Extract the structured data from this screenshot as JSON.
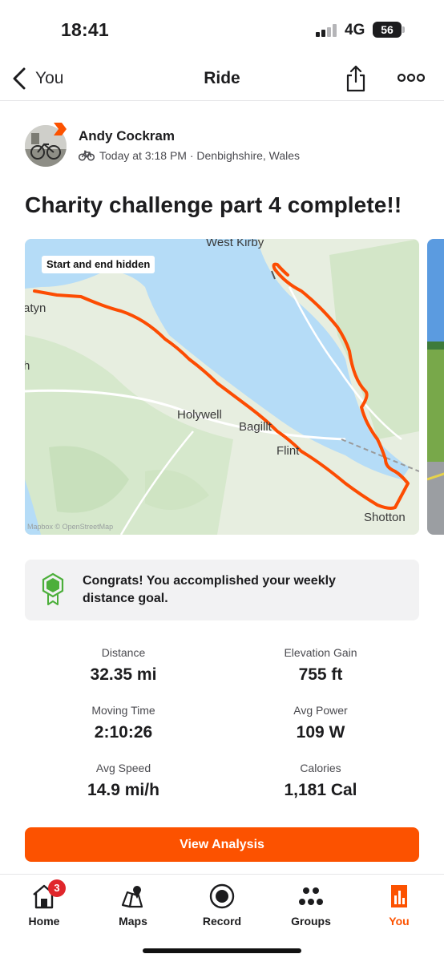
{
  "status_bar": {
    "time": "18:41",
    "network": "4G",
    "battery": "56"
  },
  "header": {
    "back_label": "You",
    "title": "Ride"
  },
  "athlete": {
    "name": "Andy Cockram",
    "meta": "Today at 3:18 PM · Denbighshire, Wales"
  },
  "activity": {
    "title": "Charity challenge part 4 complete!!"
  },
  "map": {
    "privacy_label": "Start and end hidden",
    "places": [
      "West Kirby",
      "atyn",
      "h",
      "Holywell",
      "Bagillt",
      "Flint",
      "Shotton"
    ],
    "attribution": "Mapbox © OpenStreetMap",
    "route_color": "#fc4c02",
    "water_color": "#b5dcf7"
  },
  "goal": {
    "message": "Congrats! You accomplished your weekly distance goal.",
    "icon": "hexagon-award-icon",
    "icon_color": "#4caf3a"
  },
  "stats": [
    {
      "label": "Distance",
      "value": "32.35 mi"
    },
    {
      "label": "Elevation Gain",
      "value": "755 ft"
    },
    {
      "label": "Moving Time",
      "value": "2:10:26"
    },
    {
      "label": "Avg Power",
      "value": "109 W"
    },
    {
      "label": "Avg Speed",
      "value": "14.9 mi/h"
    },
    {
      "label": "Calories",
      "value": "1,181 Cal"
    }
  ],
  "cta": {
    "label": "View Analysis",
    "color": "#fc5200"
  },
  "tabbar": {
    "tabs": [
      {
        "label": "Home",
        "icon": "home-icon",
        "badge": "3"
      },
      {
        "label": "Maps",
        "icon": "map-pin-icon"
      },
      {
        "label": "Record",
        "icon": "record-icon"
      },
      {
        "label": "Groups",
        "icon": "groups-icon"
      },
      {
        "label": "You",
        "icon": "stats-icon",
        "active": true
      }
    ]
  }
}
